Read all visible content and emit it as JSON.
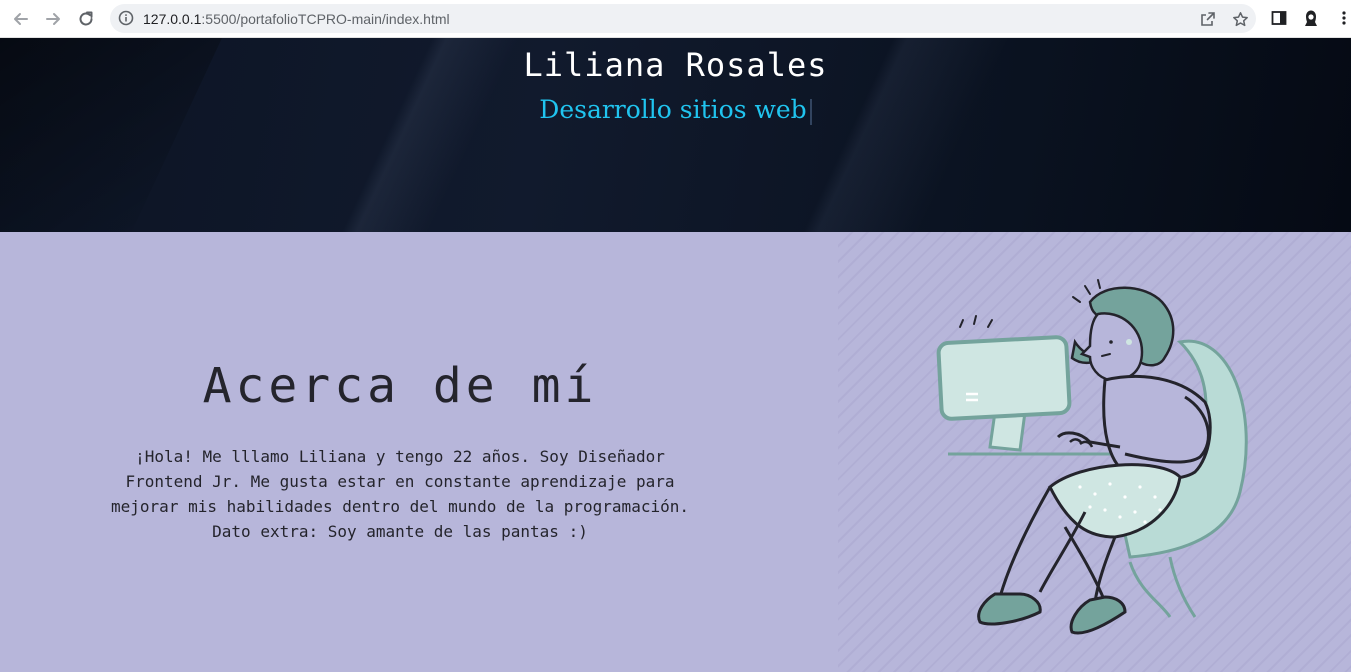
{
  "browser": {
    "url_host": "127.0.0.1",
    "url_path": ":5500/portafolioTCPRO-main/index.html",
    "icons": [
      "back-icon",
      "forward-icon",
      "reload-icon",
      "site-info-icon",
      "share-icon",
      "bookmark-star-icon",
      "side-panel-icon",
      "profile-icon",
      "menu-icon"
    ]
  },
  "hero": {
    "name": "Liliana Rosales",
    "subtitle": "Desarrollo sitios web"
  },
  "about": {
    "title": "Acerca de mí",
    "text": "¡Hola! Me lllamo Liliana y tengo 22 años. Soy Diseñador Frontend Jr. Me gusta estar en constante aprendizaje para mejorar mis habilidades dentro del mundo de la programación.",
    "extra": "Dato extra: Soy amante de las pantas :)"
  },
  "colors": {
    "hero_bg": "#0f1728",
    "hero_subtitle": "#20c4ef",
    "section_bg": "#b7b6da",
    "illustration_accent": "#74a39c",
    "illustration_light": "#cfe6e2"
  }
}
